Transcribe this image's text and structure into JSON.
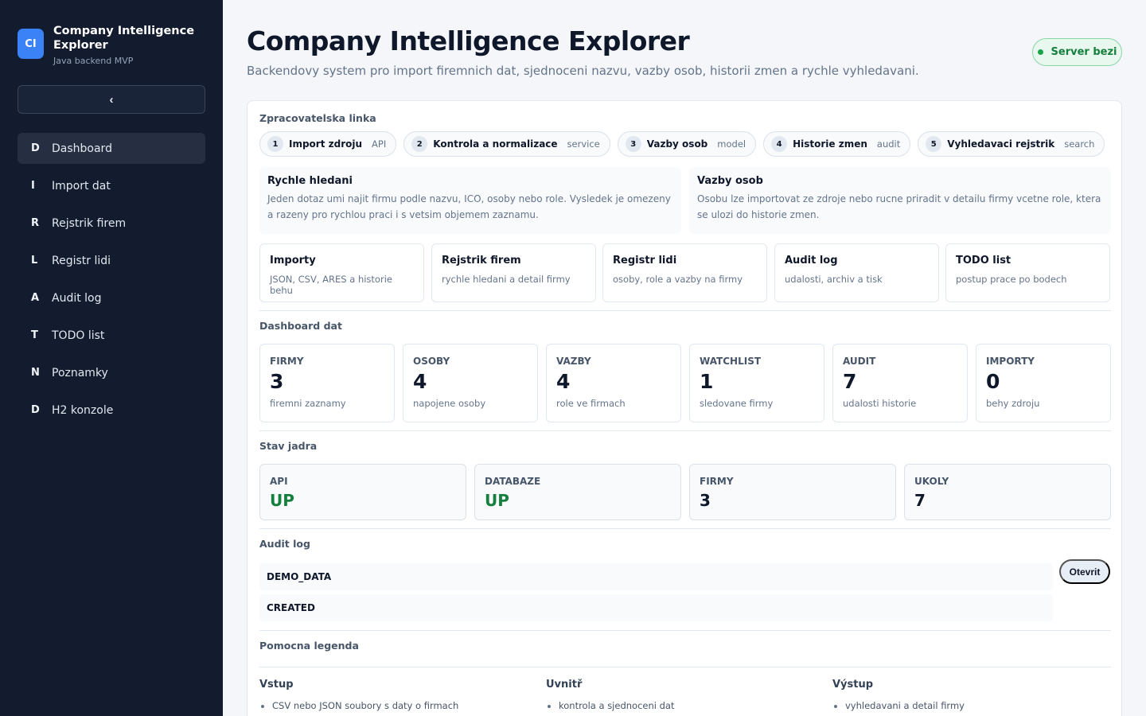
{
  "brand": {
    "logo": "CI",
    "title": "Company Intelligence Explorer",
    "subtitle": "Java backend MVP"
  },
  "sidebar": {
    "collapse_label": "‹",
    "items": [
      {
        "letter": "D",
        "label": "Dashboard",
        "active": true
      },
      {
        "letter": "I",
        "label": "Import dat"
      },
      {
        "letter": "R",
        "label": "Rejstrik firem"
      },
      {
        "letter": "L",
        "label": "Registr lidi"
      },
      {
        "letter": "A",
        "label": "Audit log"
      },
      {
        "letter": "T",
        "label": "TODO list"
      },
      {
        "letter": "N",
        "label": "Poznamky"
      },
      {
        "letter": "D",
        "label": "H2 konzole"
      }
    ]
  },
  "header": {
    "title": "Company Intelligence Explorer",
    "subtitle": "Backendovy system pro import firemnich dat, sjednoceni nazvu, vazby osob, historii zmen a rychle vyhledavani.",
    "status": "Server bezi",
    "status_color": "#16a34a"
  },
  "pipeline": {
    "label": "Zpracovatelska linka",
    "steps": [
      {
        "num": "1",
        "label": "Import zdroju",
        "tag": "API"
      },
      {
        "num": "2",
        "label": "Kontrola a normalizace",
        "tag": "service"
      },
      {
        "num": "3",
        "label": "Vazby osob",
        "tag": "model"
      },
      {
        "num": "4",
        "label": "Historie zmen",
        "tag": "audit"
      },
      {
        "num": "5",
        "label": "Vyhledavaci rejstrik",
        "tag": "search"
      }
    ]
  },
  "info": [
    {
      "title": "Rychle hledani",
      "text": "Jeden dotaz umi najit firmu podle nazvu, ICO, osoby nebo role. Vysledek je omezeny a razeny pro rychlou praci i s vetsim objemem zaznamu."
    },
    {
      "title": "Vazby osob",
      "text": "Osobu lze importovat ze zdroje nebo rucne priradit v detailu firmy vcetne role, ktera se ulozi do historie zmen."
    }
  ],
  "modules": [
    {
      "title": "Importy",
      "desc": "JSON, CSV, ARES a historie behu"
    },
    {
      "title": "Rejstrik firem",
      "desc": "rychle hledani a detail firmy"
    },
    {
      "title": "Registr lidi",
      "desc": "osoby, role a vazby na firmy"
    },
    {
      "title": "Audit log",
      "desc": "udalosti, archiv a tisk"
    },
    {
      "title": "TODO list",
      "desc": "postup prace po bodech"
    }
  ],
  "dashboard": {
    "label": "Dashboard dat",
    "stats": [
      {
        "label": "FIRMY",
        "value": "3",
        "desc": "firemni zaznamy"
      },
      {
        "label": "OSOBY",
        "value": "4",
        "desc": "napojene osoby"
      },
      {
        "label": "VAZBY",
        "value": "4",
        "desc": "role ve firmach"
      },
      {
        "label": "WATCHLIST",
        "value": "1",
        "desc": "sledovane firmy"
      },
      {
        "label": "AUDIT",
        "value": "7",
        "desc": "udalosti historie"
      },
      {
        "label": "IMPORTY",
        "value": "0",
        "desc": "behy zdroju"
      }
    ]
  },
  "core": {
    "label": "Stav jadra",
    "items": [
      {
        "label": "API",
        "value": "UP"
      },
      {
        "label": "DATABAZE",
        "value": "UP"
      },
      {
        "label": "FIRMY",
        "value": "3"
      },
      {
        "label": "UKOLY",
        "value": "7"
      }
    ],
    "up_color": "#15803d"
  },
  "audit": {
    "label": "Audit log",
    "rows": [
      "DEMO_DATA",
      "CREATED"
    ],
    "open_label": "Otevrit"
  },
  "legend": {
    "label": "Pomocna legenda",
    "columns": [
      {
        "title": "Vstup",
        "item": "CSV nebo JSON soubory s daty o firmach"
      },
      {
        "title": "Uvnitř",
        "item": "kontrola a sjednoceni dat"
      },
      {
        "title": "Výstup",
        "item": "vyhledavani a detail firmy"
      }
    ]
  },
  "accent_color": "#3b82f6"
}
